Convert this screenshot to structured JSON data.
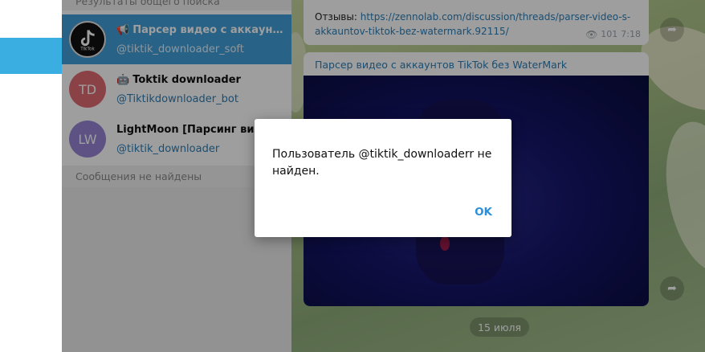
{
  "sidebar": {
    "section_results": "Результаты общего поиска",
    "section_no_messages": "Сообщения не найдены",
    "results": [
      {
        "avatar_text": "TikTok",
        "avatar_color": "#ffffff",
        "prefix_icon": "megaphone-icon",
        "title": "Парсер видео с аккаунтов TikTok без WaterMark",
        "subtitle": "@tiktik_downloader_soft",
        "active": true
      },
      {
        "avatar_text": "TD",
        "avatar_color": "#e06b73",
        "prefix_icon": "bot-icon",
        "title": "Toktik downloader",
        "subtitle": "@Tiktikdownloader_bot",
        "active": false
      },
      {
        "avatar_text": "LW",
        "avatar_color": "#9785d3",
        "prefix_icon": "",
        "title": "LightMoon [Парсинг видео",
        "subtitle": "@tiktik_downloader",
        "active": false
      }
    ]
  },
  "chat": {
    "message1": {
      "label": "Отзывы:",
      "link": "https://zennolab.com/discussion/threads/parser-video-s-akkauntov-tiktok-bez-watermark.92115/",
      "views": "101",
      "time": "7:18"
    },
    "message2": {
      "caption": "Парсер видео с аккаунтов TikTok без WaterMark"
    },
    "date_pill": "15 июля"
  },
  "modal": {
    "message": "Пользователь @tiktik_downloaderr не найден.",
    "ok_label": "OK"
  },
  "colors": {
    "accent": "#419fd9",
    "link": "#2b7fb8",
    "ok": "#2b90d9"
  }
}
